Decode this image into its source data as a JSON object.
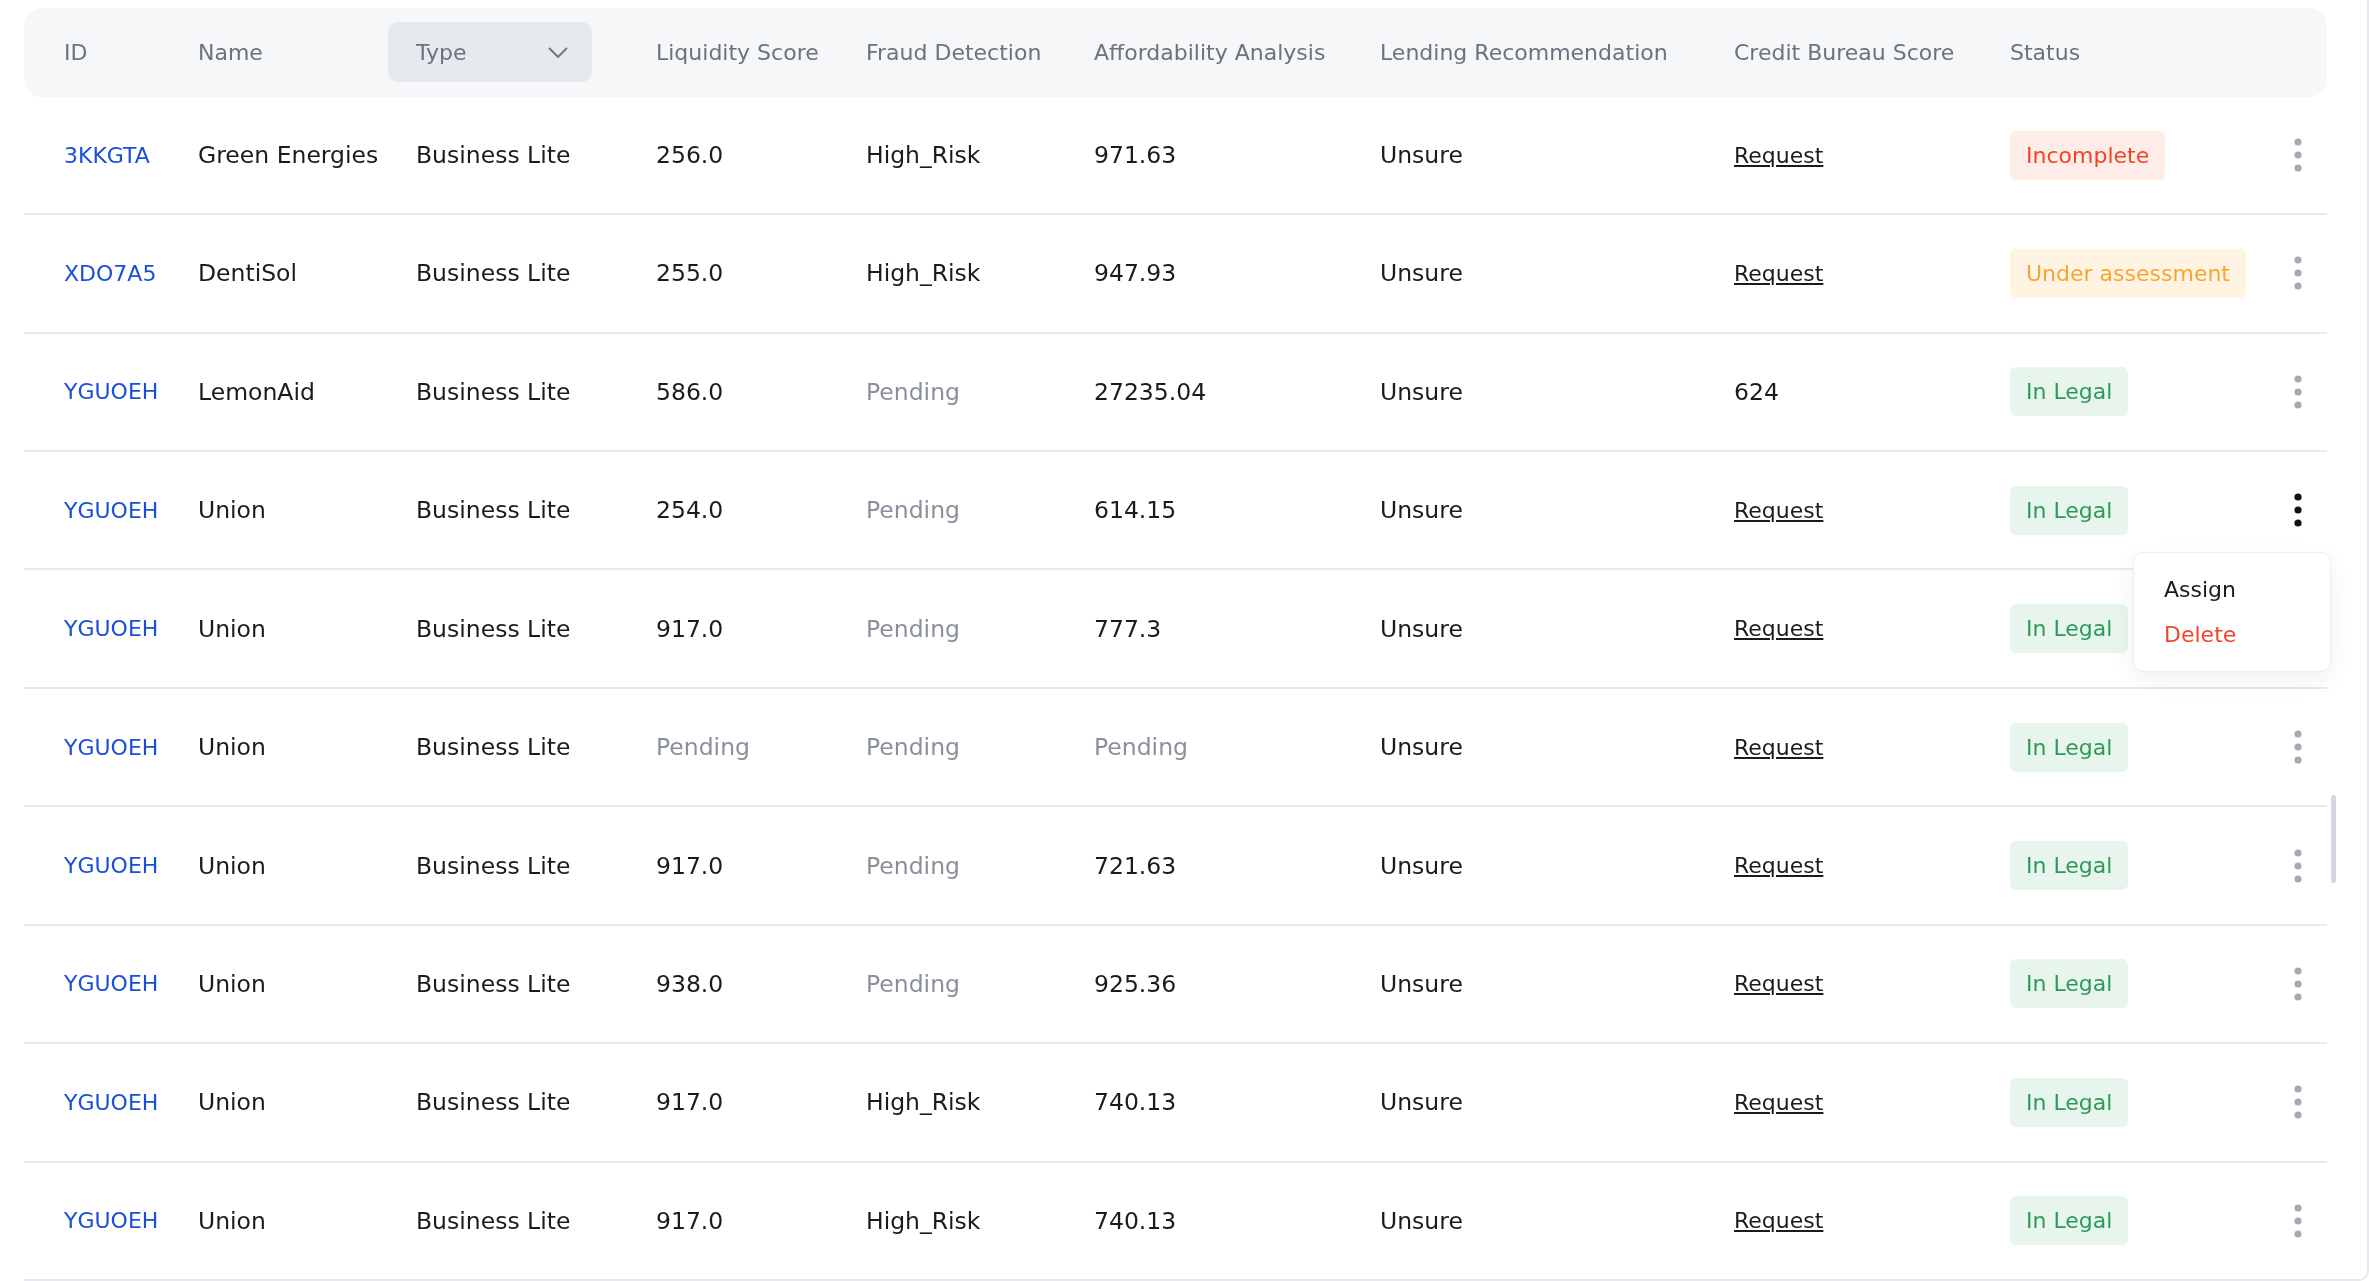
{
  "columns": [
    {
      "label": "ID",
      "kind": "text"
    },
    {
      "label": "Name",
      "kind": "text"
    },
    {
      "label": "Type",
      "kind": "dropdown"
    },
    {
      "label": "Liquidity Score",
      "kind": "text"
    },
    {
      "label": "Fraud Detection",
      "kind": "text"
    },
    {
      "label": "Affordability Analysis",
      "kind": "text"
    },
    {
      "label": "Lending Recommendation",
      "kind": "text"
    },
    {
      "label": "Credit Bureau Score",
      "kind": "text"
    },
    {
      "label": "Status",
      "kind": "text"
    }
  ],
  "rows": [
    {
      "id": "3KKGTA",
      "name": "Green Energies",
      "type": "Business Lite",
      "liquidity": {
        "text": "256.0",
        "muted": false
      },
      "fraud": {
        "text": "High_Risk",
        "muted": false
      },
      "affordability": {
        "text": "971.63",
        "muted": false
      },
      "lending": "Unsure",
      "credit": {
        "text": "Request",
        "kind": "link"
      },
      "status": {
        "text": "Incomplete",
        "kind": "incomplete"
      },
      "menu_open": false
    },
    {
      "id": "XDO7A5",
      "name": "DentiSol",
      "type": "Business Lite",
      "liquidity": {
        "text": "255.0",
        "muted": false
      },
      "fraud": {
        "text": "High_Risk",
        "muted": false
      },
      "affordability": {
        "text": "947.93",
        "muted": false
      },
      "lending": "Unsure",
      "credit": {
        "text": "Request",
        "kind": "link"
      },
      "status": {
        "text": "Under assessment",
        "kind": "assessment"
      },
      "menu_open": false
    },
    {
      "id": "YGUOEH",
      "name": "LemonAid",
      "type": "Business Lite",
      "liquidity": {
        "text": "586.0",
        "muted": false
      },
      "fraud": {
        "text": "Pending",
        "muted": true
      },
      "affordability": {
        "text": "27235.04",
        "muted": false
      },
      "lending": "Unsure",
      "credit": {
        "text": "624",
        "kind": "score"
      },
      "status": {
        "text": "In Legal",
        "kind": "legal"
      },
      "menu_open": false
    },
    {
      "id": "YGUOEH",
      "name": "Union",
      "type": "Business Lite",
      "liquidity": {
        "text": "254.0",
        "muted": false
      },
      "fraud": {
        "text": "Pending",
        "muted": true
      },
      "affordability": {
        "text": "614.15",
        "muted": false
      },
      "lending": "Unsure",
      "credit": {
        "text": "Request",
        "kind": "link"
      },
      "status": {
        "text": "In Legal",
        "kind": "legal"
      },
      "menu_open": true
    },
    {
      "id": "YGUOEH",
      "name": "Union",
      "type": "Business Lite",
      "liquidity": {
        "text": "917.0",
        "muted": false
      },
      "fraud": {
        "text": "Pending",
        "muted": true
      },
      "affordability": {
        "text": "777.3",
        "muted": false
      },
      "lending": "Unsure",
      "credit": {
        "text": "Request",
        "kind": "link"
      },
      "status": {
        "text": "In Legal",
        "kind": "legal"
      },
      "menu_open": false
    },
    {
      "id": "YGUOEH",
      "name": "Union",
      "type": "Business Lite",
      "liquidity": {
        "text": "Pending",
        "muted": true
      },
      "fraud": {
        "text": "Pending",
        "muted": true
      },
      "affordability": {
        "text": "Pending",
        "muted": true
      },
      "lending": "Unsure",
      "credit": {
        "text": "Request",
        "kind": "link"
      },
      "status": {
        "text": "In Legal",
        "kind": "legal"
      },
      "menu_open": false
    },
    {
      "id": "YGUOEH",
      "name": "Union",
      "type": "Business Lite",
      "liquidity": {
        "text": "917.0",
        "muted": false
      },
      "fraud": {
        "text": "Pending",
        "muted": true
      },
      "affordability": {
        "text": "721.63",
        "muted": false
      },
      "lending": "Unsure",
      "credit": {
        "text": "Request",
        "kind": "link"
      },
      "status": {
        "text": "In Legal",
        "kind": "legal"
      },
      "menu_open": false
    },
    {
      "id": "YGUOEH",
      "name": "Union",
      "type": "Business Lite",
      "liquidity": {
        "text": "938.0",
        "muted": false
      },
      "fraud": {
        "text": "Pending",
        "muted": true
      },
      "affordability": {
        "text": "925.36",
        "muted": false
      },
      "lending": "Unsure",
      "credit": {
        "text": "Request",
        "kind": "link"
      },
      "status": {
        "text": "In Legal",
        "kind": "legal"
      },
      "menu_open": false
    },
    {
      "id": "YGUOEH",
      "name": "Union",
      "type": "Business Lite",
      "liquidity": {
        "text": "917.0",
        "muted": false
      },
      "fraud": {
        "text": "High_Risk",
        "muted": false
      },
      "affordability": {
        "text": "740.13",
        "muted": false
      },
      "lending": "Unsure",
      "credit": {
        "text": "Request",
        "kind": "link"
      },
      "status": {
        "text": "In Legal",
        "kind": "legal"
      },
      "menu_open": false
    },
    {
      "id": "YGUOEH",
      "name": "Union",
      "type": "Business Lite",
      "liquidity": {
        "text": "917.0",
        "muted": false
      },
      "fraud": {
        "text": "High_Risk",
        "muted": false
      },
      "affordability": {
        "text": "740.13",
        "muted": false
      },
      "lending": "Unsure",
      "credit": {
        "text": "Request",
        "kind": "link"
      },
      "status": {
        "text": "In Legal",
        "kind": "legal"
      },
      "menu_open": false
    }
  ],
  "row_menu": [
    {
      "label": "Assign",
      "kind": "normal"
    },
    {
      "label": "Delete",
      "kind": "danger"
    }
  ]
}
